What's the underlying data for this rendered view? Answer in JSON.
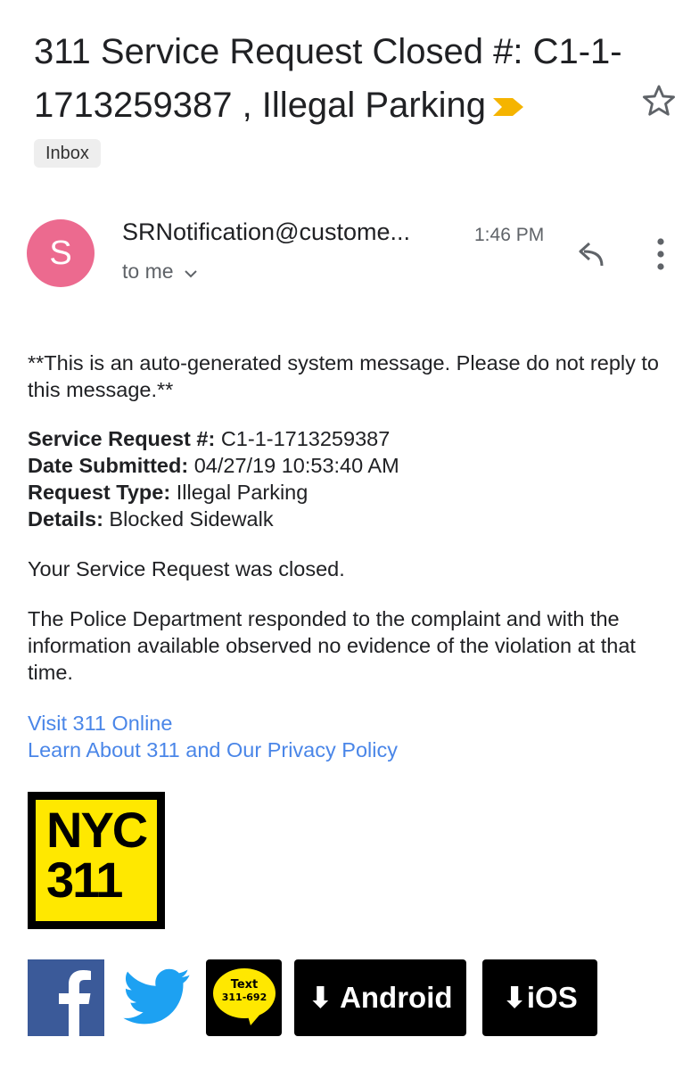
{
  "email": {
    "subject": "311 Service Request Closed #: C1-1-1713259387 , Illegal Parking",
    "label": "Inbox",
    "avatar_letter": "S",
    "sender": "SRNotification@custome...",
    "time": "1:46 PM",
    "recipient": "to me"
  },
  "body": {
    "disclaimer": "**This is an auto-generated system message. Please do not reply to this message.**",
    "fields": [
      {
        "label": "Service Request #:",
        "value": " C1-1-1713259387"
      },
      {
        "label": "Date Submitted:",
        "value": " 04/27/19 10:53:40 AM"
      },
      {
        "label": "Request Type:",
        "value": " Illegal Parking"
      },
      {
        "label": "Details:",
        "value": " Blocked Sidewalk"
      }
    ],
    "closed_message": "Your Service Request was closed.",
    "response_message": "The Police Department responded to the complaint and with the information available observed no evidence of the violation at that time.",
    "links": [
      "Visit 311 Online",
      "Learn About 311 and Our Privacy Policy"
    ]
  },
  "logo": {
    "line1": "NYC",
    "line2": "311"
  },
  "footer": {
    "text_badge_line1": "Text",
    "text_badge_line2": "311-692",
    "android_label": "Android",
    "ios_label": "iOS"
  },
  "icons": {
    "importance": "importance-marker-icon",
    "star": "star-icon",
    "reply": "reply-icon",
    "more": "more-vert-icon",
    "chevron": "chevron-down-icon",
    "facebook": "facebook-icon",
    "twitter": "twitter-icon",
    "download": "download-arrow-icon"
  },
  "colors": {
    "avatar": "#ec6a8f",
    "importance": "#f5b400",
    "link": "#4a86e8",
    "nyc_yellow": "#ffe800",
    "facebook": "#3b5a99",
    "twitter": "#1da1f2"
  }
}
